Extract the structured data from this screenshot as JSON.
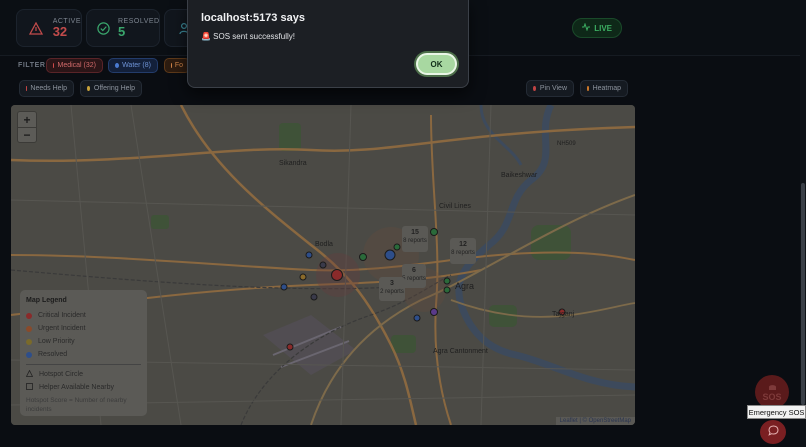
{
  "stats": {
    "active": {
      "label": "ACTIVE",
      "value": "32"
    },
    "resolved": {
      "label": "RESOLVED",
      "value": "5"
    }
  },
  "live_label": "LIVE",
  "filters": {
    "label": "FILTER",
    "chips": [
      "Medical (32)",
      "Water (8)",
      "Fo"
    ]
  },
  "help_buttons": [
    "Needs Help",
    "Offering Help"
  ],
  "view_buttons": [
    "Pin View",
    "Heatmap"
  ],
  "map": {
    "zoom_in": "+",
    "zoom_out": "−",
    "places": [
      "Sikandra",
      "Bodla",
      "Baikeshwar",
      "Civil Lines",
      "Agra",
      "Agra Cantonment",
      "Tajganj",
      "NH509"
    ],
    "clusters": [
      {
        "count": "15",
        "caption": "8 reports"
      },
      {
        "count": "12",
        "caption": "8 reports"
      },
      {
        "count": "6",
        "caption": "5 reports"
      },
      {
        "count": "3",
        "caption": "2 reports"
      }
    ],
    "attribution": "Leaflet | © OpenStreetMap"
  },
  "legend": {
    "title": "Map Legend",
    "items": [
      {
        "label": "Critical Incident",
        "color": "#c83a3a"
      },
      {
        "label": "Urgent Incident",
        "color": "#d06a2a"
      },
      {
        "label": "Low Priority",
        "color": "#b89a2a"
      },
      {
        "label": "Resolved",
        "color": "#3a6ac8"
      }
    ],
    "hotspot_circle": "Hotspot Circle",
    "helper_nearby": "Helper Available Nearby",
    "note": "Hotspot Score = Number of nearby incidents"
  },
  "dialog": {
    "title": "localhost:5173 says",
    "message": "🚨 SOS sent successfully!",
    "ok_label": "OK"
  },
  "sos": {
    "label": "SOS",
    "tooltip": "Emergency SOS"
  }
}
